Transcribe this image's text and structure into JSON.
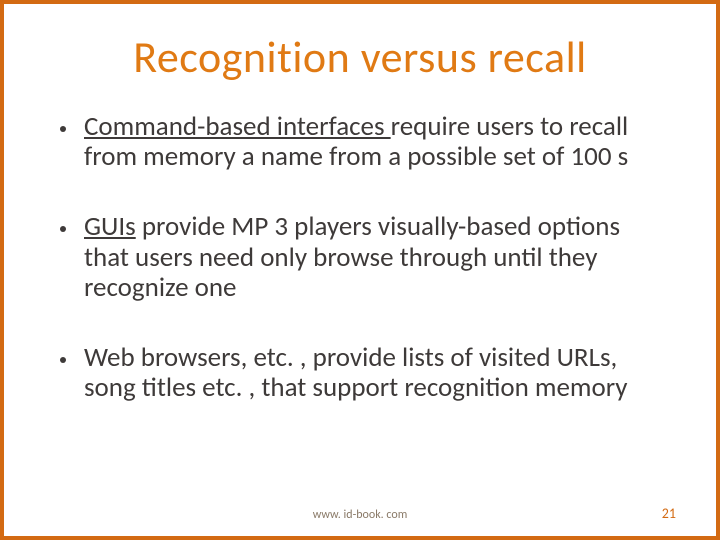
{
  "title": "Recognition versus recall",
  "bullets": [
    {
      "underlined": "Command-based interfaces ",
      "rest": "require users to recall from memory a name from a possible set of 100 s"
    },
    {
      "underlined": "GUIs",
      "rest": " provide MP 3 players visually-based options that users need only browse through until they recognize one"
    },
    {
      "underlined": "",
      "rest": "Web browsers, etc. , provide lists of visited URLs, song titles etc. , that support recognition memory"
    }
  ],
  "footer_url": "www. id-book. com",
  "page_number": "21"
}
